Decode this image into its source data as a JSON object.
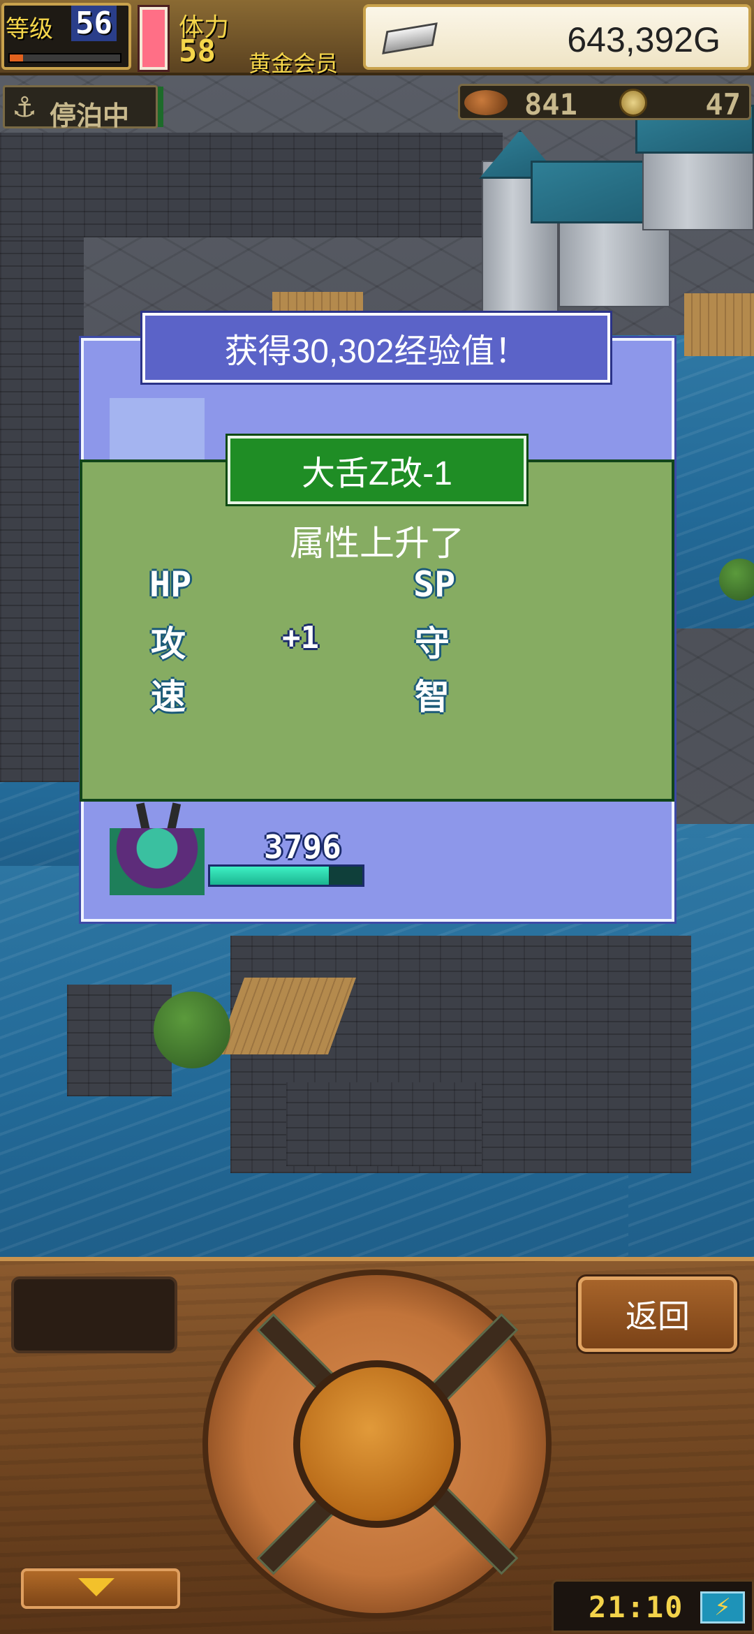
{
  "hud": {
    "level_label": "等级",
    "level_value": "56",
    "level_progress": 0.12,
    "stamina_label": "体力",
    "stamina_value": "58",
    "member_label": "黄金会员",
    "gold_value": "643,392G",
    "docked_label": "停泊中",
    "food_value": "841",
    "coin_value": "47"
  },
  "result_dialog": {
    "exp_text": "获得30,302经验值！",
    "hp_value": "3796",
    "hp_ratio": 0.78
  },
  "statup_dialog": {
    "unit_name": "大舌Z改-1",
    "title": "属性上升了",
    "stats": {
      "hp": {
        "label": "HP",
        "gain": ""
      },
      "sp": {
        "label": "SP",
        "gain": ""
      },
      "atk": {
        "label": "攻",
        "gain": "+1"
      },
      "def": {
        "label": "守",
        "gain": ""
      },
      "spd": {
        "label": "速",
        "gain": ""
      },
      "int": {
        "label": "智",
        "gain": ""
      }
    }
  },
  "controls": {
    "back_label": "返回",
    "clock": "21:10",
    "battery_glyph": "⚡"
  },
  "colors": {
    "result_dialog_bg": "#8d97ea",
    "statup_dialog_bg": "#86ac62",
    "name_banner_bg": "#1f8d25",
    "hp_bar": "#3ef0c4",
    "panel_wood": "#7a4a22"
  }
}
